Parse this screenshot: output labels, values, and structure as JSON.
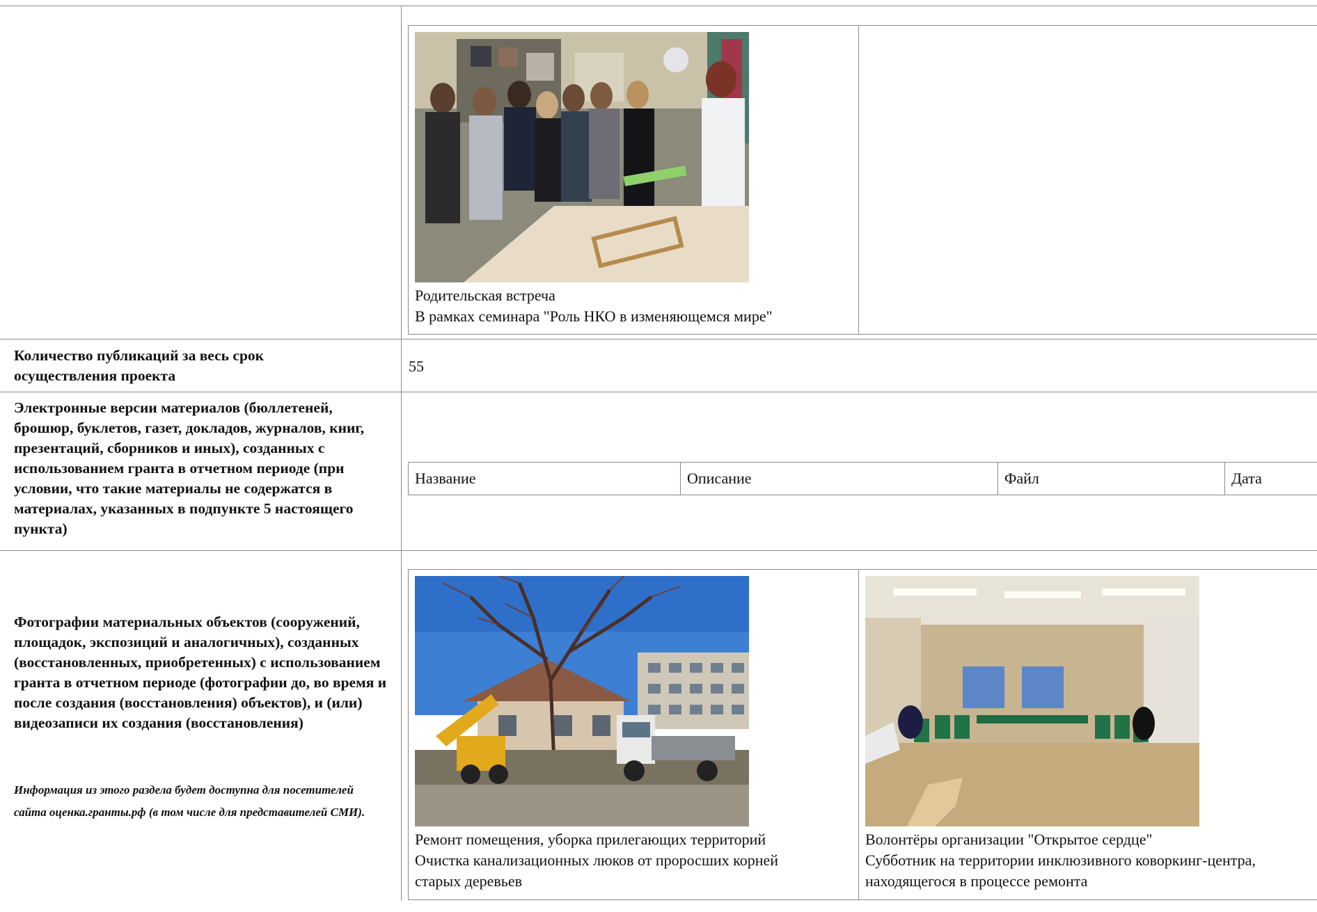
{
  "gallery_top": {
    "items": [
      {
        "photo_icon": "group-meeting-photo",
        "title": "Родительская встреча",
        "description": "В рамках семинара \"Роль НКО в изменяющемся мире\""
      }
    ]
  },
  "publications": {
    "label": "Количество публикаций за весь срок осуществления проекта",
    "value": "55"
  },
  "materials": {
    "label": "Электронные версии материалов (бюллетеней, брошюр, буклетов, газет, докладов, журналов, книг, презентаций, сборников и иных), созданных с использованием гранта в отчетном периоде (при условии, что такие материалы не содержатся в материалах, указанных в подпункте 5 настоящего пункта)",
    "columns": [
      "Название",
      "Описание",
      "Файл",
      "Дата"
    ]
  },
  "objects": {
    "label": "Фотографии материальных объектов (сооружений, площадок, экспозиций и аналогичных), созданных (восстановленных, приобретенных) с использованием гранта в отчетном периоде (фотографии до, во время и после создания (восстановления) объектов), и (или) видеозаписи их создания (восстановления)",
    "note": "Информация из этого раздела будет доступна для посетителей сайта оценка.гранты.рф (в том числе для представителей СМИ).",
    "items": [
      {
        "photo_icon": "excavator-truck-photo",
        "title": "Ремонт помещения, уборка прилегающих территорий",
        "description_lines": [
          "Очистка канализационных люков от проросших корней",
          "старых деревьев"
        ]
      },
      {
        "photo_icon": "coworking-room-photo",
        "title": "Волонтёры организации \"Открытое сердце\"",
        "description_lines": [
          "Субботник на территории инклюзивного коворкинг-центра,",
          "находящегося в процессе ремонта"
        ]
      }
    ]
  }
}
